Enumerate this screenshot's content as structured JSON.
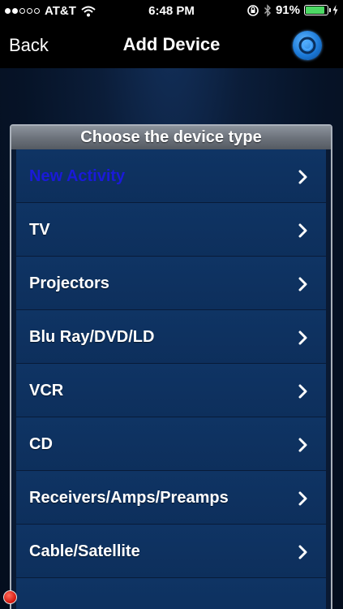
{
  "status_bar": {
    "carrier": "AT&T",
    "time": "6:48 PM",
    "battery_percent": "91%",
    "battery_level": 0.91,
    "signal_bars_filled": 2,
    "signal_bars_total": 5
  },
  "nav": {
    "back_label": "Back",
    "title": "Add Device",
    "power_icon": "power-icon"
  },
  "panel": {
    "header": "Choose the device type",
    "items": [
      {
        "label": "New Activity"
      },
      {
        "label": "TV"
      },
      {
        "label": "Projectors"
      },
      {
        "label": "Blu Ray/DVD/LD"
      },
      {
        "label": "VCR"
      },
      {
        "label": "CD"
      },
      {
        "label": "Receivers/Amps/Preamps"
      },
      {
        "label": "Cable/Satellite"
      },
      {
        "label": ""
      }
    ]
  },
  "colors": {
    "accent": "#1c7ad8",
    "highlight_item": "#1a1ad8",
    "battery": "#4cd964"
  }
}
